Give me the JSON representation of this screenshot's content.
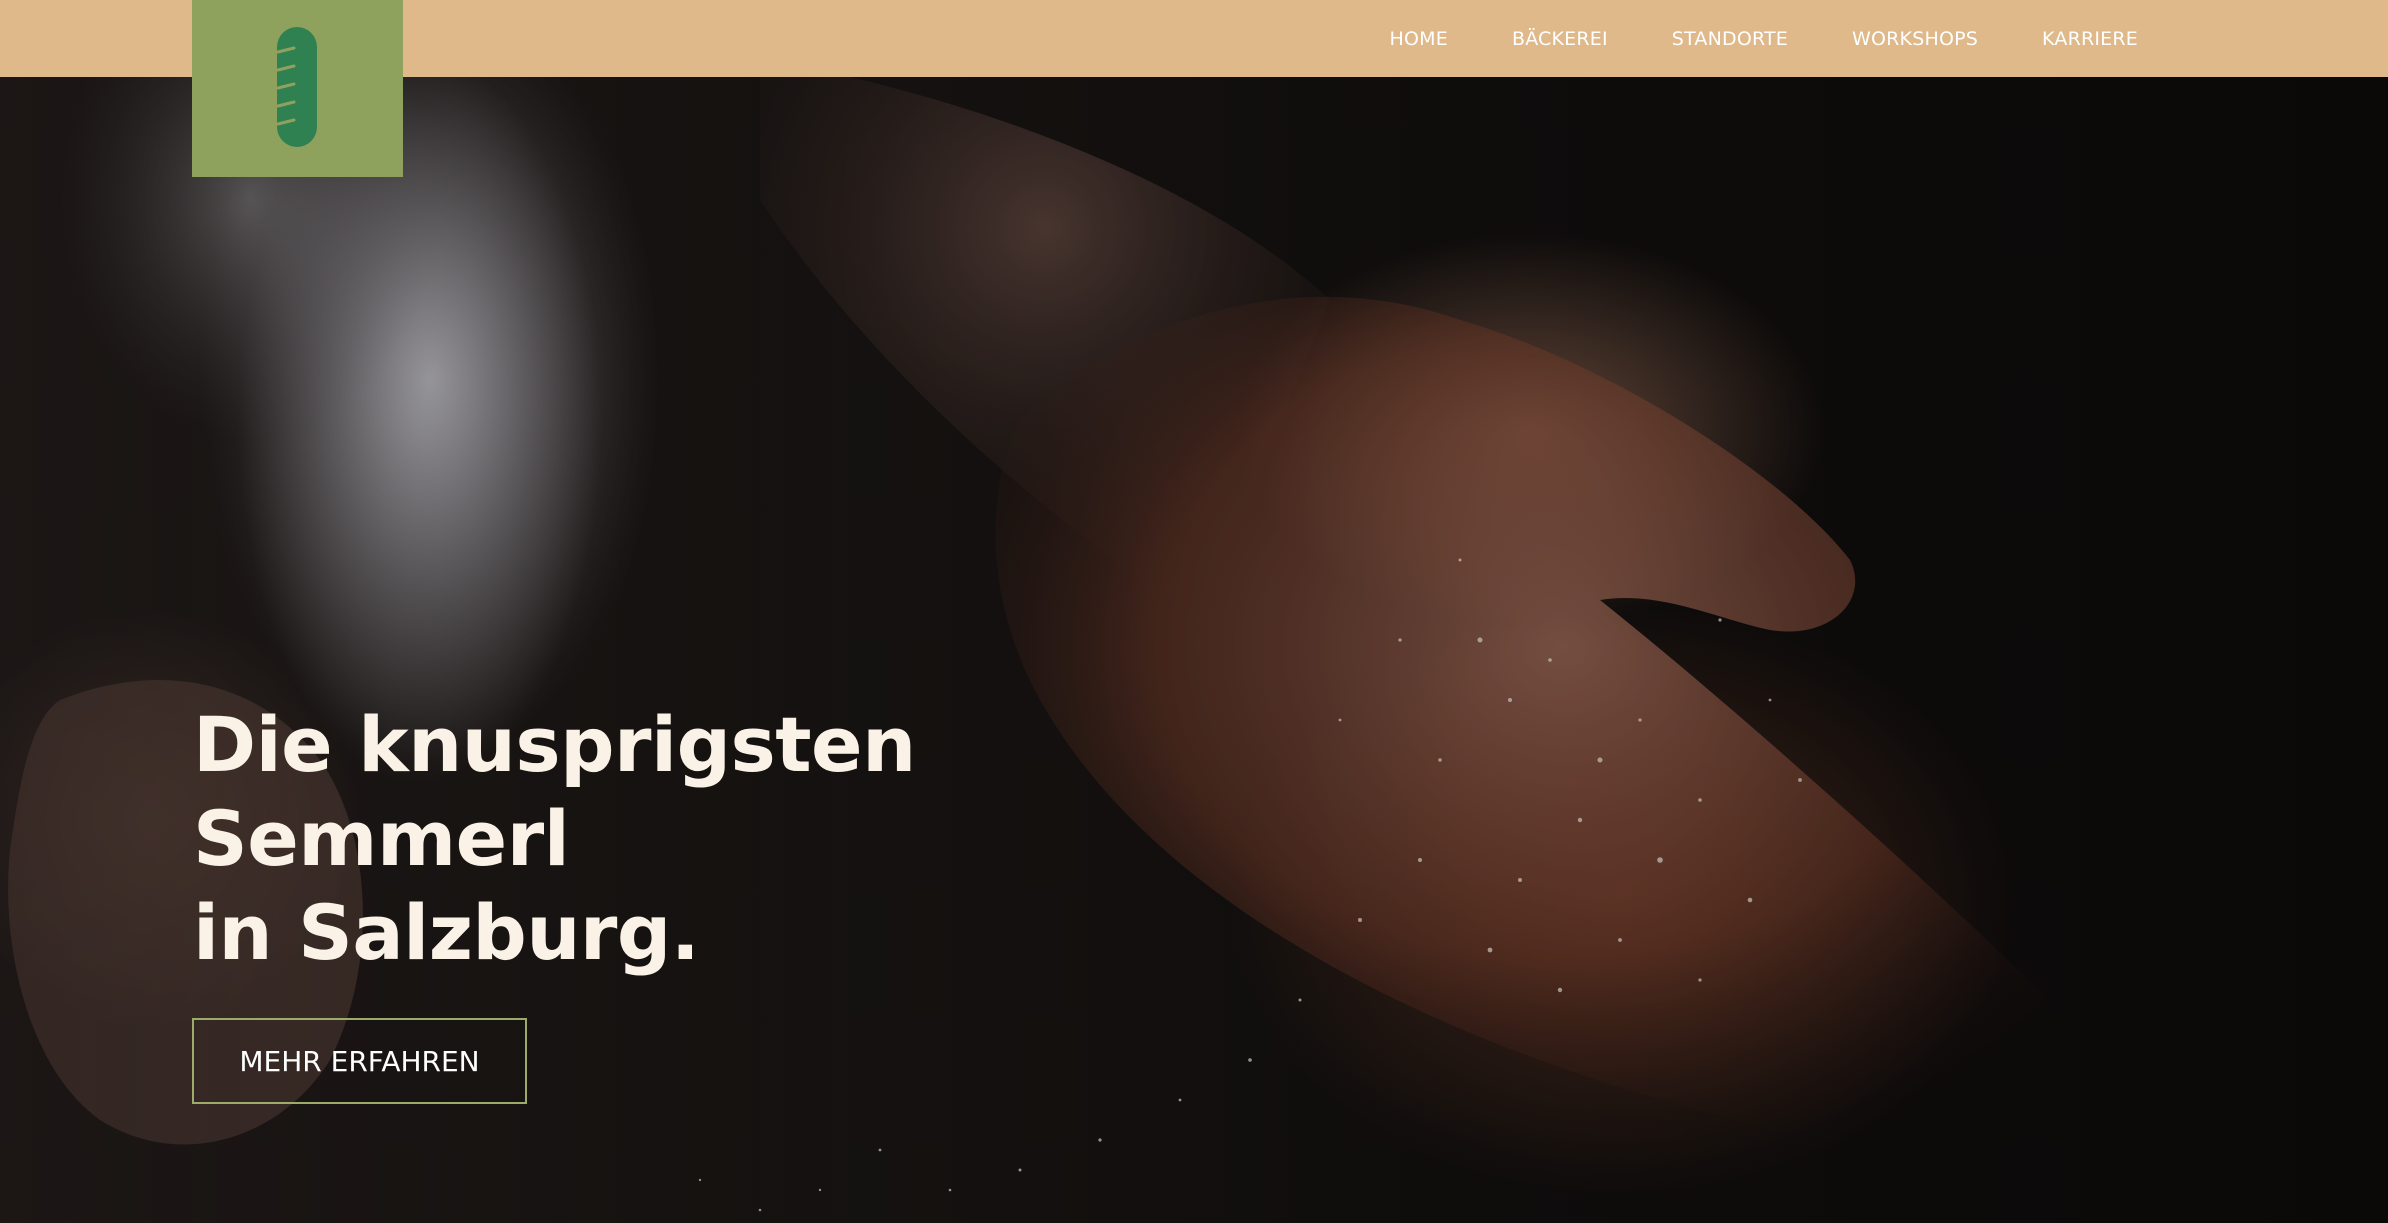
{
  "brand": {
    "logo_icon": "bread-loaf-icon",
    "logo_bg_color": "#8fa25d",
    "logo_icon_color": "#2f8152"
  },
  "topbar": {
    "bg_color": "#dfb98a"
  },
  "nav": {
    "items": [
      {
        "label": "HOME"
      },
      {
        "label": "BÄCKEREI"
      },
      {
        "label": "STANDORTE"
      },
      {
        "label": "WORKSHOPS"
      },
      {
        "label": "KARRIERE"
      }
    ]
  },
  "hero": {
    "headline_lines": [
      "Die knusprigsten",
      "Semmerl",
      "in Salzburg."
    ],
    "cta_label": "MEHR ERFAHREN",
    "cta_border_color": "#9cab69",
    "text_color": "#faf2e6"
  }
}
